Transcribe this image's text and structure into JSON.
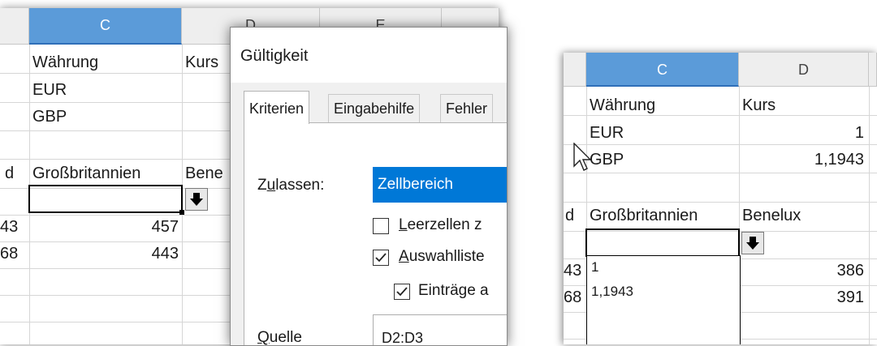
{
  "left_sheet": {
    "col_headers": [
      "C",
      "D",
      "E"
    ],
    "rows": {
      "waehrung": "Währung",
      "kurs_clipped": "Kurs",
      "eur": "EUR",
      "gbp": "GBP",
      "label_d_clipped": "d",
      "gb_header": "Großbritannien",
      "benelux_clipped": "Bene",
      "num_left_1": "43",
      "num_left_2": "68",
      "val_1": "457",
      "val_2": "443"
    }
  },
  "dialog": {
    "title": "Gültigkeit",
    "tabs": [
      "Kriterien",
      "Eingabehilfe",
      "Fehler"
    ],
    "allow_label_pre": "Z",
    "allow_label_u": "u",
    "allow_label_post": "lassen:",
    "allow_value": "Zellbereich",
    "opt_blank_u": "L",
    "opt_blank": "eerzellen z",
    "opt_list_u": "A",
    "opt_list": "uswahlliste",
    "opt_sort": "Einträge a",
    "source_label_u": "Q",
    "source_label": "uelle",
    "source_value": "D2:D3"
  },
  "right_sheet": {
    "col_headers": [
      "C",
      "D"
    ],
    "waehrung": "Währung",
    "kurs": "Kurs",
    "eur": "EUR",
    "eur_rate": "1",
    "gbp": "GBP",
    "gbp_rate": "1,1943",
    "label_d_clipped": "d",
    "gb_header": "Großbritannien",
    "benelux": "Benelux",
    "num_left_1": "43",
    "num_left_2": "68",
    "val_1": "386",
    "val_2": "391",
    "dropdown_options": [
      "1",
      "1,1943"
    ]
  },
  "colors": {
    "selected_header": "#5b9bd9",
    "selection_blue": "#0078d7"
  }
}
